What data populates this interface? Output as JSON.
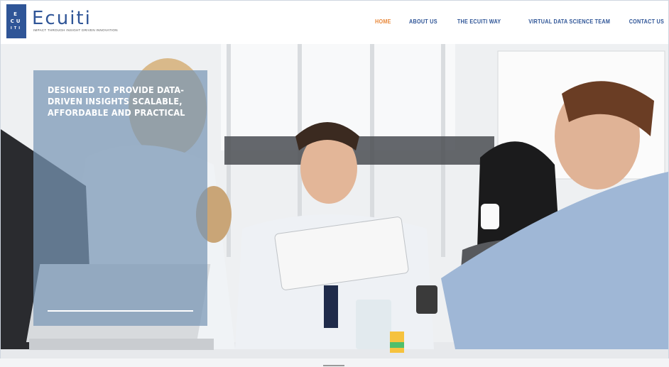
{
  "brand": {
    "logo_rows": [
      "E",
      "CU",
      "ITI"
    ],
    "name": "Ecuiti",
    "tagline": "IMPACT THROUGH INSIGHT DRIVEN INNOVATION"
  },
  "nav": {
    "items": [
      {
        "label": "HOME",
        "active": true
      },
      {
        "label": "ABOUT US",
        "active": false
      },
      {
        "label": "THE ECUITI WAY",
        "active": false
      },
      {
        "label": "VIRTUAL DATA SCIENCE TEAM",
        "active": false
      },
      {
        "label": "CONTACT US",
        "active": false
      }
    ]
  },
  "hero": {
    "headline": "DESIGNED TO PROVIDE DATA-DRIVEN INSIGHTS SCALABLE, AFFORDABLE AND PRACTICAL",
    "image_subject": "business team meeting"
  },
  "colors": {
    "brand": "#2f5597",
    "nav_active": "#e8883a",
    "panel": "#7896b4"
  }
}
